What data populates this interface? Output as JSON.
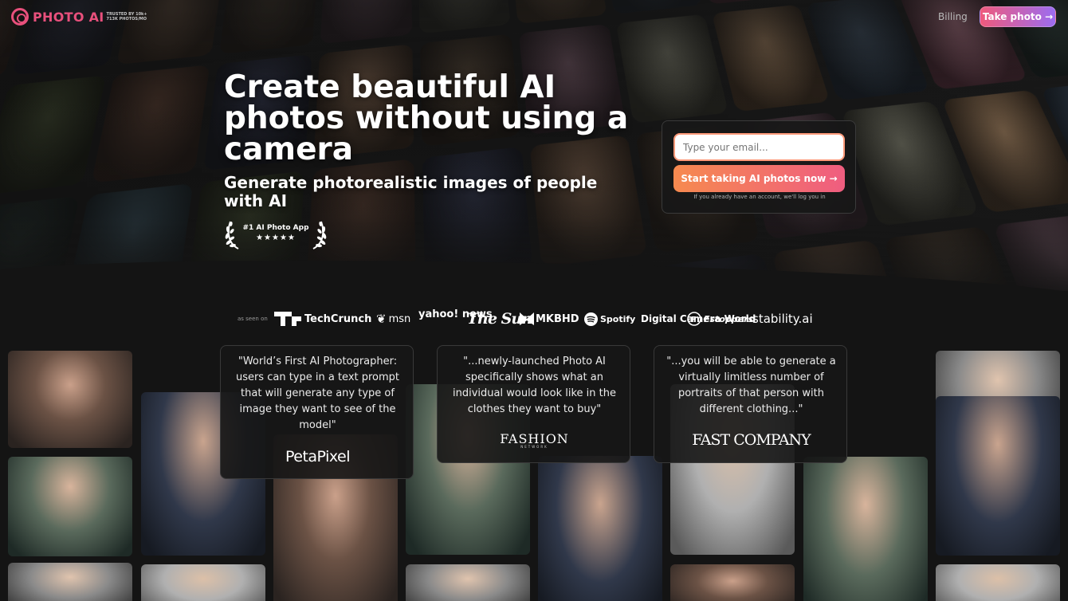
{
  "nav": {
    "logo_text": "PHOTO AI",
    "logo_stats_line1": "TRUSTED BY 10k+",
    "logo_stats_line2": "713K PHOTOS/MO",
    "billing_label": "Billing",
    "cta_label": "Take photo →"
  },
  "hero": {
    "headline": "Create beautiful AI photos without using a camera",
    "subheadline": "Generate photorealistic images of people with AI",
    "award_title": "#1 AI Photo App",
    "award_stars": "★★★★★"
  },
  "signup": {
    "email_placeholder": "Type your email...",
    "button_label": "Start taking AI photos now →",
    "note": "If you already have an account, we'll log you in"
  },
  "press": {
    "seen_on": "as seen on",
    "logos": [
      "TechCrunch",
      "msn",
      "yahoo! news",
      "The Sun",
      "MKBHD",
      "Spotify",
      "Digital Camera World",
      "Fstoppers",
      "stability.ai"
    ]
  },
  "testimonials": [
    {
      "quote": "\"World’s First AI Photographer: users can type in a text prompt that will generate any type of image they want to see of the model\"",
      "brand": "PetaPixel"
    },
    {
      "quote": "\"...newly-launched Photo AI specifically shows what an individual would look like in the clothes they want to buy\"",
      "brand": "FASHION",
      "brand_sub": "NETWORK"
    },
    {
      "quote": "\"...you will be able to generate a virtually limitless number of portraits of that person with different clothing...\"",
      "brand": "FAST COMPANY"
    }
  ]
}
